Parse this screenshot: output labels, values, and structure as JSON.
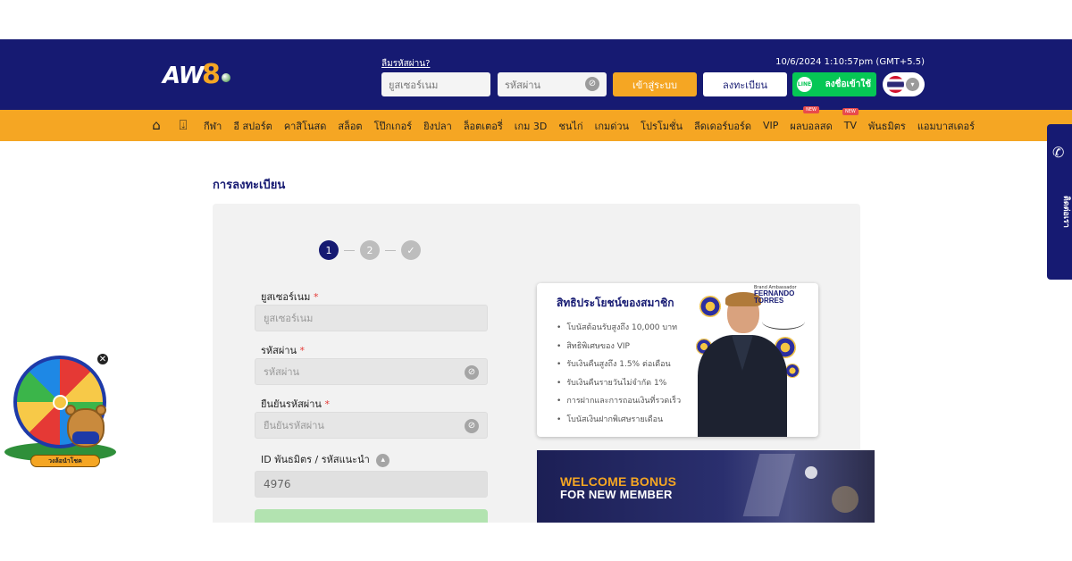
{
  "header": {
    "logo": {
      "text_aw": "AW",
      "text_8": "8"
    },
    "forgot_password_link": "ลืมรหัสผ่าน?",
    "username_placeholder": "ยูสเซอร์เนม",
    "password_placeholder": "รหัสผ่าน",
    "login_button": "เข้าสู่ระบบ",
    "register_button": "ลงทะเบียน",
    "line_icon_text": "LINE",
    "line_login_button": "ลงชื่อเข้าใช้",
    "datetime": "10/6/2024 1:10:57pm (GMT+5.5)",
    "language": "th-flag-icon"
  },
  "nav": {
    "icons": [
      "home-icon",
      "download-icon"
    ],
    "items": [
      {
        "label": "กีฬา"
      },
      {
        "label": "อี สปอร์ต"
      },
      {
        "label": "คาสิโนสด"
      },
      {
        "label": "สล็อต"
      },
      {
        "label": "โป๊กเกอร์"
      },
      {
        "label": "ยิงปลา"
      },
      {
        "label": "ล็อตเตอรี่"
      },
      {
        "label": "เกม 3D"
      },
      {
        "label": "ชนไก่"
      },
      {
        "label": "เกมด่วน"
      },
      {
        "label": "โปรโมชั่น"
      },
      {
        "label": "ลีดเดอร์บอร์ด"
      },
      {
        "label": "VIP"
      },
      {
        "label": "ผลบอลสด",
        "badge": "NEW"
      },
      {
        "label": "TV",
        "badge": "NEW"
      },
      {
        "label": "พันธมิตร"
      },
      {
        "label": "แอมบาสเดอร์"
      }
    ]
  },
  "main": {
    "page_title": "การลงทะเบียน",
    "steps": [
      "1",
      "2",
      "✓"
    ],
    "form": {
      "username_label": "ยูสเซอร์เนม",
      "username_placeholder": "ยูสเซอร์เนม",
      "password_label": "รหัสผ่าน",
      "password_placeholder": "รหัสผ่าน",
      "confirm_label": "ยืนยันรหัสผ่าน",
      "confirm_placeholder": "ยืนยันรหัสผ่าน",
      "required_mark": "*",
      "referral_label": "ID พันธมิตร / รหัสแนะนำ",
      "referral_value": "4976"
    },
    "benefits": {
      "title": "สิทธิประโยชน์ของสมาชิก",
      "items": [
        "โบนัสต้อนรับสูงถึง 10,000 บาท",
        "สิทธิพิเศษของ VIP",
        "รับเงินคืนสูงถึง 1.5% ต่อเดือน",
        "รับเงินคืนรายวันไม่จำกัด 1%",
        "การฝากและการถอนเงินที่รวดเร็ว",
        "โบนัสเงินฝากพิเศษรายเดือน"
      ],
      "ambassador_label": "Brand Ambassador",
      "ambassador_name": "FERNANDO TORRES"
    },
    "bonus_banner": {
      "line1": "WELCOME BONUS",
      "line2": "FOR NEW MEMBER"
    }
  },
  "contact_tab": {
    "label": "ติดต่อเรา"
  },
  "spin_widget": {
    "label": "วงล้อนำโชค"
  }
}
